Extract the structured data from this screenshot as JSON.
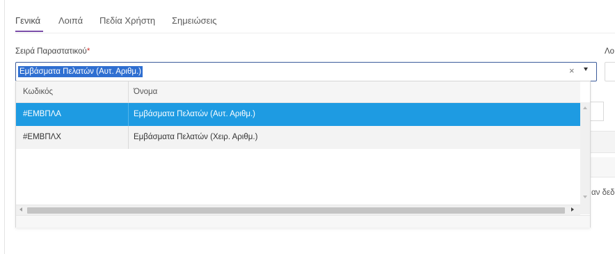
{
  "tabs": [
    {
      "label": "Γενικά",
      "active": true
    },
    {
      "label": "Λοιπά",
      "active": false
    },
    {
      "label": "Πεδία Χρήστη",
      "active": false
    },
    {
      "label": "Σημειώσεις",
      "active": false
    }
  ],
  "series_field": {
    "label": "Σειρά Παραστατικού",
    "required_mark": "*",
    "value": "Εμβάσματα Πελατών (Αυτ. Αριθμ.)",
    "clear_glyph": "×"
  },
  "right_field_label_partial": "Λο",
  "right_partial_text": "αν δεδ",
  "dropdown": {
    "columns": [
      "Κωδικός",
      "Όνομα"
    ],
    "rows": [
      {
        "code": "#ΕΜΒΠΛΑ",
        "name": "Εμβάσματα Πελατών (Αυτ. Αριθμ.)",
        "selected": true
      },
      {
        "code": "#ΕΜΒΠΛΧ",
        "name": "Εμβάσματα Πελατών (Χειρ. Αριθμ.)",
        "selected": false
      }
    ]
  },
  "icons": {
    "clear": "close-icon",
    "open": "chevron-down-icon",
    "scroll_up": "scroll-up-arrow-icon",
    "scroll_down": "scroll-down-arrow-icon",
    "scroll_left": "scroll-left-arrow-icon",
    "scroll_right": "scroll-right-arrow-icon"
  },
  "colors": {
    "accent": "#7b4ea8",
    "selected_row": "#1e9be2",
    "text_highlight": "#2f6fd1",
    "focus_border": "#3b5b9a",
    "required": "#d0312d"
  }
}
